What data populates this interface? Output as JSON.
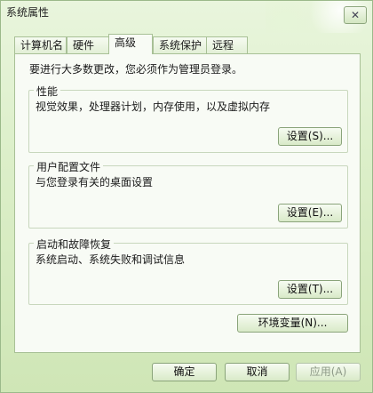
{
  "window": {
    "title": "系统属性",
    "close_glyph": "✕"
  },
  "tabs": [
    {
      "label": "计算机名"
    },
    {
      "label": "硬件"
    },
    {
      "label": "高级",
      "active": true
    },
    {
      "label": "系统保护"
    },
    {
      "label": "远程"
    }
  ],
  "advanced": {
    "intro": "要进行大多数更改，您必须作为管理员登录。",
    "performance": {
      "title": "性能",
      "description": "视觉效果，处理器计划，内存使用，以及虚拟内存",
      "button": "设置(S)..."
    },
    "user_profiles": {
      "title": "用户配置文件",
      "description": "与您登录有关的桌面设置",
      "button": "设置(E)..."
    },
    "startup_recovery": {
      "title": "启动和故障恢复",
      "description": "系统启动、系统失败和调试信息",
      "button": "设置(T)..."
    },
    "env_vars_button": "环境变量(N)..."
  },
  "footer": {
    "ok": "确定",
    "cancel": "取消",
    "apply": "应用(A)"
  }
}
